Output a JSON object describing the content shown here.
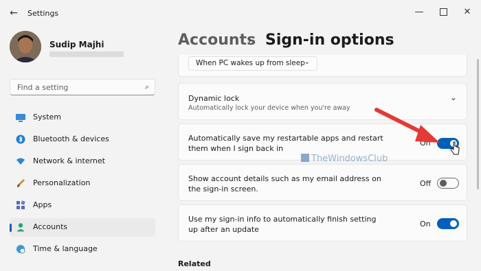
{
  "titlebar": {
    "back_icon": "back-arrow-icon",
    "title": "Settings",
    "minimize_icon": "minimize-icon",
    "maximize_icon": "maximize-icon",
    "close_icon": "close-icon"
  },
  "profile": {
    "name": "Sudip Majhi"
  },
  "search": {
    "placeholder": "Find a setting",
    "icon": "search-icon"
  },
  "nav": {
    "items": [
      {
        "label": "System",
        "icon": "monitor-icon"
      },
      {
        "label": "Bluetooth & devices",
        "icon": "bluetooth-icon"
      },
      {
        "label": "Network & internet",
        "icon": "wifi-icon"
      },
      {
        "label": "Personalization",
        "icon": "brush-icon"
      },
      {
        "label": "Apps",
        "icon": "apps-icon"
      },
      {
        "label": "Accounts",
        "icon": "person-icon",
        "active": true
      },
      {
        "label": "Time & language",
        "icon": "globe-clock-icon"
      }
    ]
  },
  "header": {
    "root": "Accounts",
    "separator": "›",
    "current": "Sign-in options"
  },
  "cards": {
    "wake": {
      "dropdown_value": "When PC wakes up from sleep"
    },
    "dynamic_lock": {
      "title": "Dynamic lock",
      "subtitle": "Automatically lock your device when you're away"
    },
    "restart_apps": {
      "title_line1": "Automatically save my restartable apps and restart",
      "title_line2": "them when I sign back in",
      "state": "On"
    },
    "account_details": {
      "title_line1": "Show account details such as my email address on",
      "title_line2": "the sign-in screen.",
      "state": "Off"
    },
    "signin_info": {
      "title_line1": "Use my sign-in info to automatically finish setting",
      "title_line2": "up after an update",
      "state": "On"
    }
  },
  "related": {
    "label": "Related"
  },
  "watermark": {
    "text": "TheWindowsClub"
  },
  "colors": {
    "accent": "#005fb8",
    "annotation_arrow": "#e53935"
  }
}
